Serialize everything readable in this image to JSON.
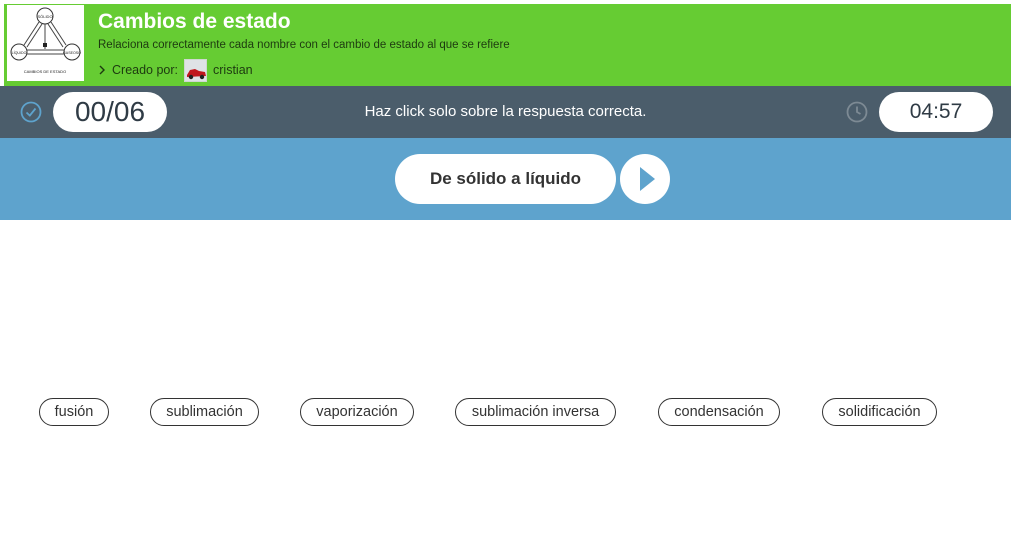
{
  "header": {
    "title": "Cambios de estado",
    "subtitle": "Relaciona correctamente cada nombre con el cambio de estado al que se refiere",
    "creator_label": "Creado por:",
    "creator_name": "cristian",
    "thumbnail": {
      "caption": "CAMBIOS DE ESTADO",
      "labels": [
        "SÓLIDO",
        "LÍQUIDO",
        "GASEOSO"
      ]
    }
  },
  "status": {
    "score": "00/06",
    "instruction": "Haz click solo sobre la respuesta correcta.",
    "timer": "04:57"
  },
  "question": {
    "text": "De sólido a líquido"
  },
  "answers": [
    "fusión",
    "sublimación",
    "vaporización",
    "sublimación inversa",
    "condensación",
    "solidificación"
  ],
  "icons": {
    "score": "check-circle-icon",
    "timer": "clock-icon",
    "play": "play-icon",
    "creator": "chevron-right-icon",
    "avatar": "red-car-avatar"
  },
  "colors": {
    "header_bg": "#66cc33",
    "statusbar_bg": "#4b5d6b",
    "questionbar_bg": "#5ea3cd",
    "accent_blue": "#5ea3cd",
    "text_dark": "#333333"
  }
}
